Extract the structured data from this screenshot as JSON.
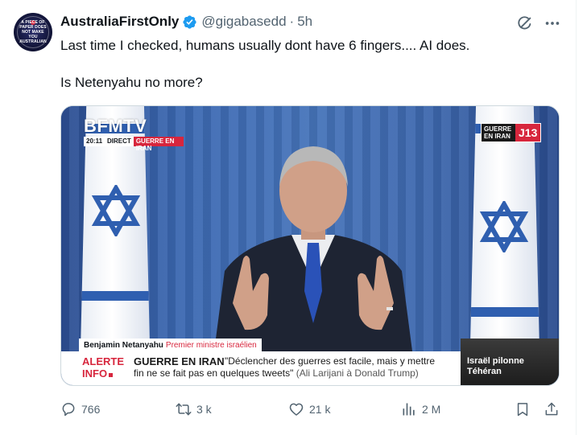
{
  "tweet": {
    "avatar_text": "A piece of paper does not make you Australian",
    "display_name": "AustraliaFirstOnly",
    "handle": "@gigabasedd",
    "separator": "·",
    "time": "5h",
    "text_line1": "Last time I checked, humans usually dont have 6 fingers.... AI does.",
    "text_line2": "Is Netenyahu no more?"
  },
  "media": {
    "channel_logo": "BFMTV",
    "clock": "20:11",
    "live_label": "DIRECT",
    "live_tag": "GUERRE EN IRAN",
    "corner_badge_text": "GUERRE EN IRAN",
    "corner_badge_code": "J13",
    "speaker_name": "Benjamin Netanyahu",
    "speaker_role": "Premier ministre israélien",
    "alert_label_1": "ALERTE",
    "alert_label_2": "INFO",
    "alert_headline": "GUERRE EN IRAN",
    "alert_quote_1": "\"Déclencher des guerres est facile, mais y mettre",
    "alert_quote_2": "fin ne se fait pas en quelques tweets\"",
    "alert_attribution": "(Ali Larijani à Donald Trump)",
    "side_text_1": "Israël pilonne",
    "side_text_2": "Téhéran"
  },
  "actions": {
    "replies": "766",
    "reposts": "3 k",
    "likes": "21 k",
    "views": "2 M"
  },
  "colors": {
    "verified": "#1d9bf0",
    "text": "#0f1419",
    "secondary": "#536471",
    "bfm_red": "#d7263d"
  },
  "icons": [
    "verified-badge-icon",
    "grok-icon",
    "more-icon",
    "reply-icon",
    "repost-icon",
    "like-icon",
    "views-icon",
    "bookmark-icon",
    "share-icon"
  ]
}
